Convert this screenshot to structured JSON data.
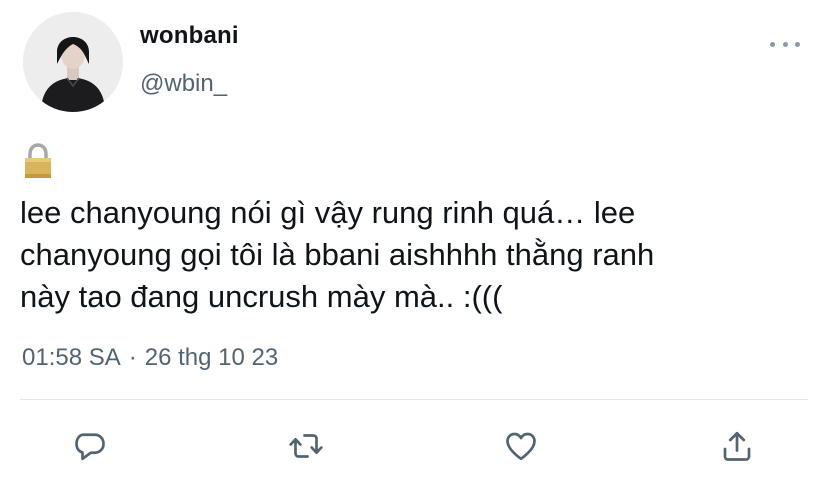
{
  "user": {
    "display_name": "wonbani",
    "handle": "@wbin_"
  },
  "tweet": {
    "text": "lee chanyoung nói gì vậy rung rinh quá… lee\nchanyoung gọi tôi là bbani aishhhh thằng ranh\nnày tao đang uncrush mày mà.. :(((",
    "time": "01:58 SA",
    "separator": "·",
    "date": "26 thg 10 23"
  },
  "icons": {
    "lock": "lock-emoji-icon",
    "more": "more-options-icon",
    "reply": "reply-icon",
    "retweet": "retweet-icon",
    "like": "like-icon",
    "share": "share-icon"
  },
  "colors": {
    "text": "#0f1419",
    "secondary": "#536471",
    "icon": "#536471",
    "divider": "#e1e8ed"
  }
}
